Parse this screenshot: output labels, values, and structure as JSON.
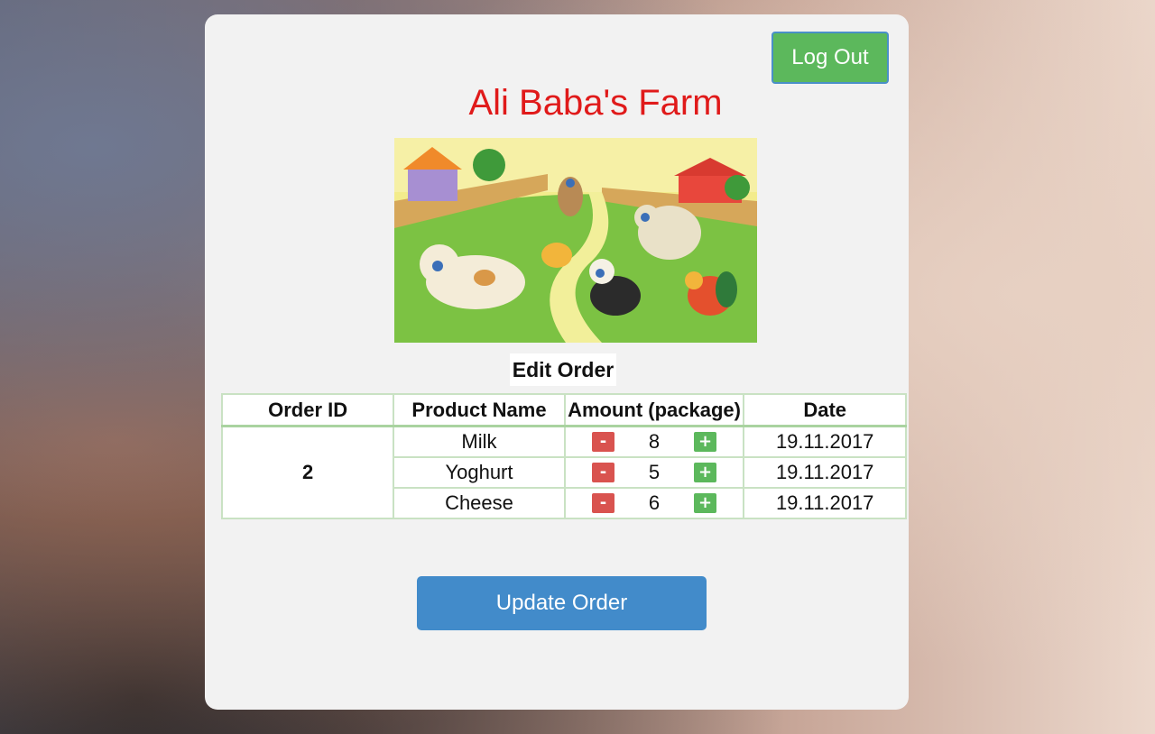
{
  "header": {
    "logout_label": "Log Out",
    "title": "Ali Baba's Farm"
  },
  "section": {
    "heading": "Edit Order"
  },
  "table": {
    "headers": [
      "Order ID",
      "Product Name",
      "Amount (package)",
      "Date"
    ],
    "order_id": "2",
    "rows": [
      {
        "product": "Milk",
        "amount": "8",
        "date": "19.11.2017"
      },
      {
        "product": "Yoghurt",
        "amount": "5",
        "date": "19.11.2017"
      },
      {
        "product": "Cheese",
        "amount": "6",
        "date": "19.11.2017"
      }
    ],
    "minus_symbol": "-",
    "plus_symbol": "+"
  },
  "footer": {
    "update_label": "Update Order"
  },
  "colors": {
    "title": "#e01a1a",
    "logout": "#5cb85c",
    "update": "#428bca",
    "minus": "#d9534f",
    "plus": "#5cb85c",
    "table_border": "#c9e2c3"
  }
}
